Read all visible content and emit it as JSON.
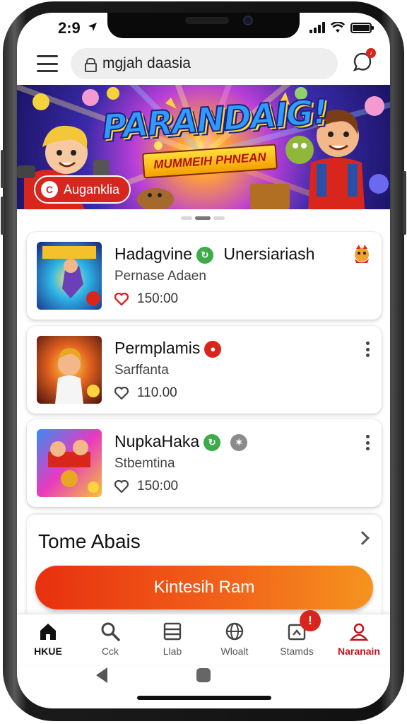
{
  "status_bar": {
    "time": "2:9",
    "icons": [
      "location-arrow-icon",
      "signal-icon",
      "wifi-icon",
      "battery-icon"
    ]
  },
  "topbar": {
    "menu_icon": "hamburger-icon",
    "search_text": "mgjah daasia",
    "lock_icon": "lock-icon",
    "notification_icon": "chat-bell-icon"
  },
  "banner": {
    "title": "PARANDAIG!",
    "subtitle": "MUMMEIH PHNEAN",
    "button_label": "Auganklia",
    "button_icon": "C",
    "slides": 3,
    "active_slide": 2
  },
  "cards": [
    {
      "title": "Hadagvine",
      "tag": "Unersiariash",
      "subtitle": "Pernase Adaen",
      "price": "150:00",
      "favorited": true,
      "badge_color": "#3dab4a",
      "badge_glyph": "↻",
      "action": "character-icon"
    },
    {
      "title": "Permplamis",
      "tag": "",
      "subtitle": "Sarffanta",
      "price": "110.00",
      "favorited": false,
      "badge_color": "#d8261c",
      "badge_glyph": "●",
      "action": "more-icon"
    },
    {
      "title": "NupkaHaka",
      "tag": "",
      "subtitle": "Stbemtina",
      "price": "150:00",
      "favorited": false,
      "badge_color": "#3dab4a",
      "badge_glyph": "↻",
      "badge2_color": "#8b8b8b",
      "badge2_glyph": "✶",
      "action": "more-icon"
    }
  ],
  "section": {
    "title": "Tome Abais",
    "button_label": "Kintesih Ram"
  },
  "bottom_nav": [
    {
      "label": "HKUE",
      "icon": "home-icon",
      "state": "active"
    },
    {
      "label": "Cck",
      "icon": "search-icon",
      "state": ""
    },
    {
      "label": "Llab",
      "icon": "list-icon",
      "state": ""
    },
    {
      "label": "Wloalt",
      "icon": "globe-icon",
      "state": ""
    },
    {
      "label": "Stamds",
      "icon": "scan-icon",
      "state": "",
      "badge": "!"
    },
    {
      "label": "Naranain",
      "icon": "profile-icon",
      "state": "red"
    }
  ],
  "colors": {
    "accent": "#d8261c",
    "cta_start": "#e8300f",
    "cta_end": "#f5941e",
    "favorite": "#d8261c"
  }
}
